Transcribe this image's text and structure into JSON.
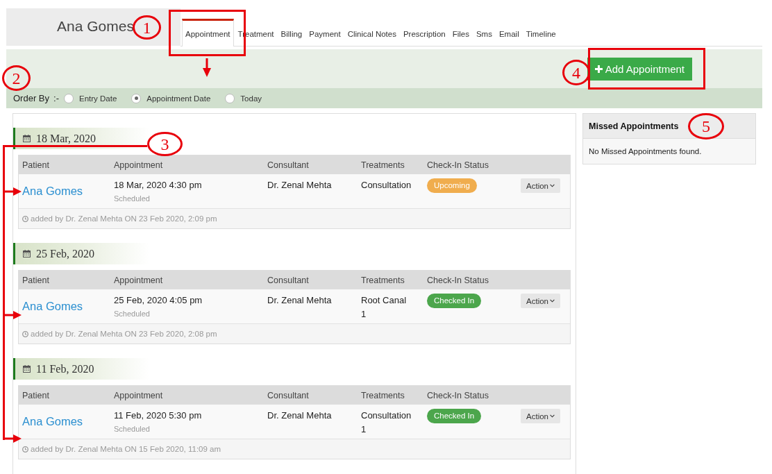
{
  "patient_name": "Ana Gomes",
  "tabs": [
    {
      "label": "Appointment",
      "selected": true
    },
    {
      "label": "Treatment",
      "selected": false
    },
    {
      "label": "Billing",
      "selected": false
    },
    {
      "label": "Payment",
      "selected": false
    },
    {
      "label": "Clinical Notes",
      "selected": false
    },
    {
      "label": "Prescription",
      "selected": false
    },
    {
      "label": "Files",
      "selected": false
    },
    {
      "label": "Sms",
      "selected": false
    },
    {
      "label": "Email",
      "selected": false
    },
    {
      "label": "Timeline",
      "selected": false
    }
  ],
  "add_appointment_button": "Add Appointment",
  "order_by": {
    "label": "Order By",
    "separator": ":-",
    "options": [
      {
        "label": "Entry Date",
        "selected": false
      },
      {
        "label": "Appointment Date",
        "selected": true
      },
      {
        "label": "Today",
        "selected": false
      }
    ]
  },
  "appointment_groups": [
    {
      "date": "18 Mar, 2020",
      "columns": [
        "Patient",
        "Appointment",
        "Consultant",
        "Treatments",
        "Check-In Status"
      ],
      "patient": "Ana Gomes",
      "appointment_time": "18 Mar, 2020 4:30 pm",
      "appointment_status": "Scheduled",
      "consultant": "Dr. Zenal Mehta",
      "treatment": "Consultation",
      "check_in": {
        "label": "Upcoming",
        "color": "#f0ad4e"
      },
      "action_button": "Action",
      "added_by": "added by Dr. Zenal Mehta ON 23 Feb 2020, 2:09 pm"
    },
    {
      "date": "25 Feb, 2020",
      "columns": [
        "Patient",
        "Appointment",
        "Consultant",
        "Treatments",
        "Check-In Status"
      ],
      "patient": "Ana Gomes",
      "appointment_time": "25 Feb, 2020 4:05 pm",
      "appointment_status": "Scheduled",
      "consultant": "Dr. Zenal Mehta",
      "treatment": "Root Canal",
      "treatment_count": "1",
      "check_in": {
        "label": "Checked In",
        "color": "#4ca64c"
      },
      "action_button": "Action",
      "added_by": "added by Dr. Zenal Mehta ON 23 Feb 2020, 2:08 pm"
    },
    {
      "date": "11 Feb, 2020",
      "columns": [
        "Patient",
        "Appointment",
        "Consultant",
        "Treatments",
        "Check-In Status"
      ],
      "patient": "Ana Gomes",
      "appointment_time": "11 Feb, 2020 5:30 pm",
      "appointment_status": "Scheduled",
      "consultant": "Dr. Zenal Mehta",
      "treatment": "Consultation",
      "treatment_count": "1",
      "check_in": {
        "label": "Checked In",
        "color": "#4ca64c"
      },
      "action_button": "Action",
      "added_by": "added by Dr. Zenal Mehta ON 15 Feb 2020, 11:09 am"
    }
  ],
  "missed_appointments": {
    "title": "Missed Appointments",
    "message": "No Missed Appointments found."
  },
  "annotations": [
    {
      "kind": "number",
      "label": "1"
    },
    {
      "kind": "frame"
    },
    {
      "kind": "arrow"
    },
    {
      "kind": "number",
      "label": "2"
    },
    {
      "kind": "number",
      "label": "3"
    },
    {
      "kind": "connector"
    },
    {
      "kind": "number",
      "label": "4"
    },
    {
      "kind": "frame"
    },
    {
      "kind": "number",
      "label": "5"
    }
  ]
}
